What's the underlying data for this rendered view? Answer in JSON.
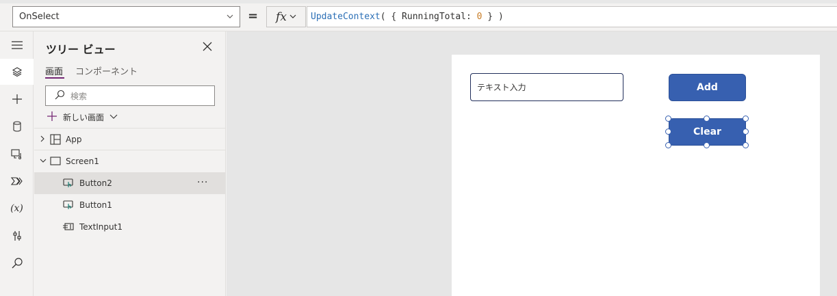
{
  "formula_bar": {
    "property": "OnSelect",
    "equals": "=",
    "fx_label": "fx",
    "formula": {
      "func": "UpdateContext",
      "open": "( { RunningTotal: ",
      "value": "0",
      "close": " } )"
    }
  },
  "rail": {
    "icons": [
      "hamburger-icon",
      "layers-icon",
      "plus-icon",
      "data-icon",
      "media-icon",
      "power-automate-icon",
      "variables-icon",
      "tools-icon",
      "search-icon"
    ],
    "variables_glyph": "(x)"
  },
  "tree": {
    "title": "ツリー ビュー",
    "tabs": [
      {
        "label": "画面",
        "active": true
      },
      {
        "label": "コンポーネント",
        "active": false
      }
    ],
    "search_placeholder": "検索",
    "new_screen_label": "新しい画面",
    "items": [
      {
        "label": "App",
        "icon": "app-icon"
      },
      {
        "label": "Screen1",
        "icon": "screen-icon"
      },
      {
        "label": "Button2",
        "icon": "button-icon",
        "selected": true
      },
      {
        "label": "Button1",
        "icon": "button-icon"
      },
      {
        "label": "TextInput1",
        "icon": "text-input-icon"
      }
    ],
    "more_label": "···"
  },
  "canvas": {
    "text_input_value": "テキスト入力",
    "add_label": "Add",
    "clear_label": "Clear",
    "button_color": "#3760b0"
  },
  "colors": {
    "accent": "#742774",
    "formula_function": "#2b6fb6",
    "formula_number": "#c87d27"
  }
}
